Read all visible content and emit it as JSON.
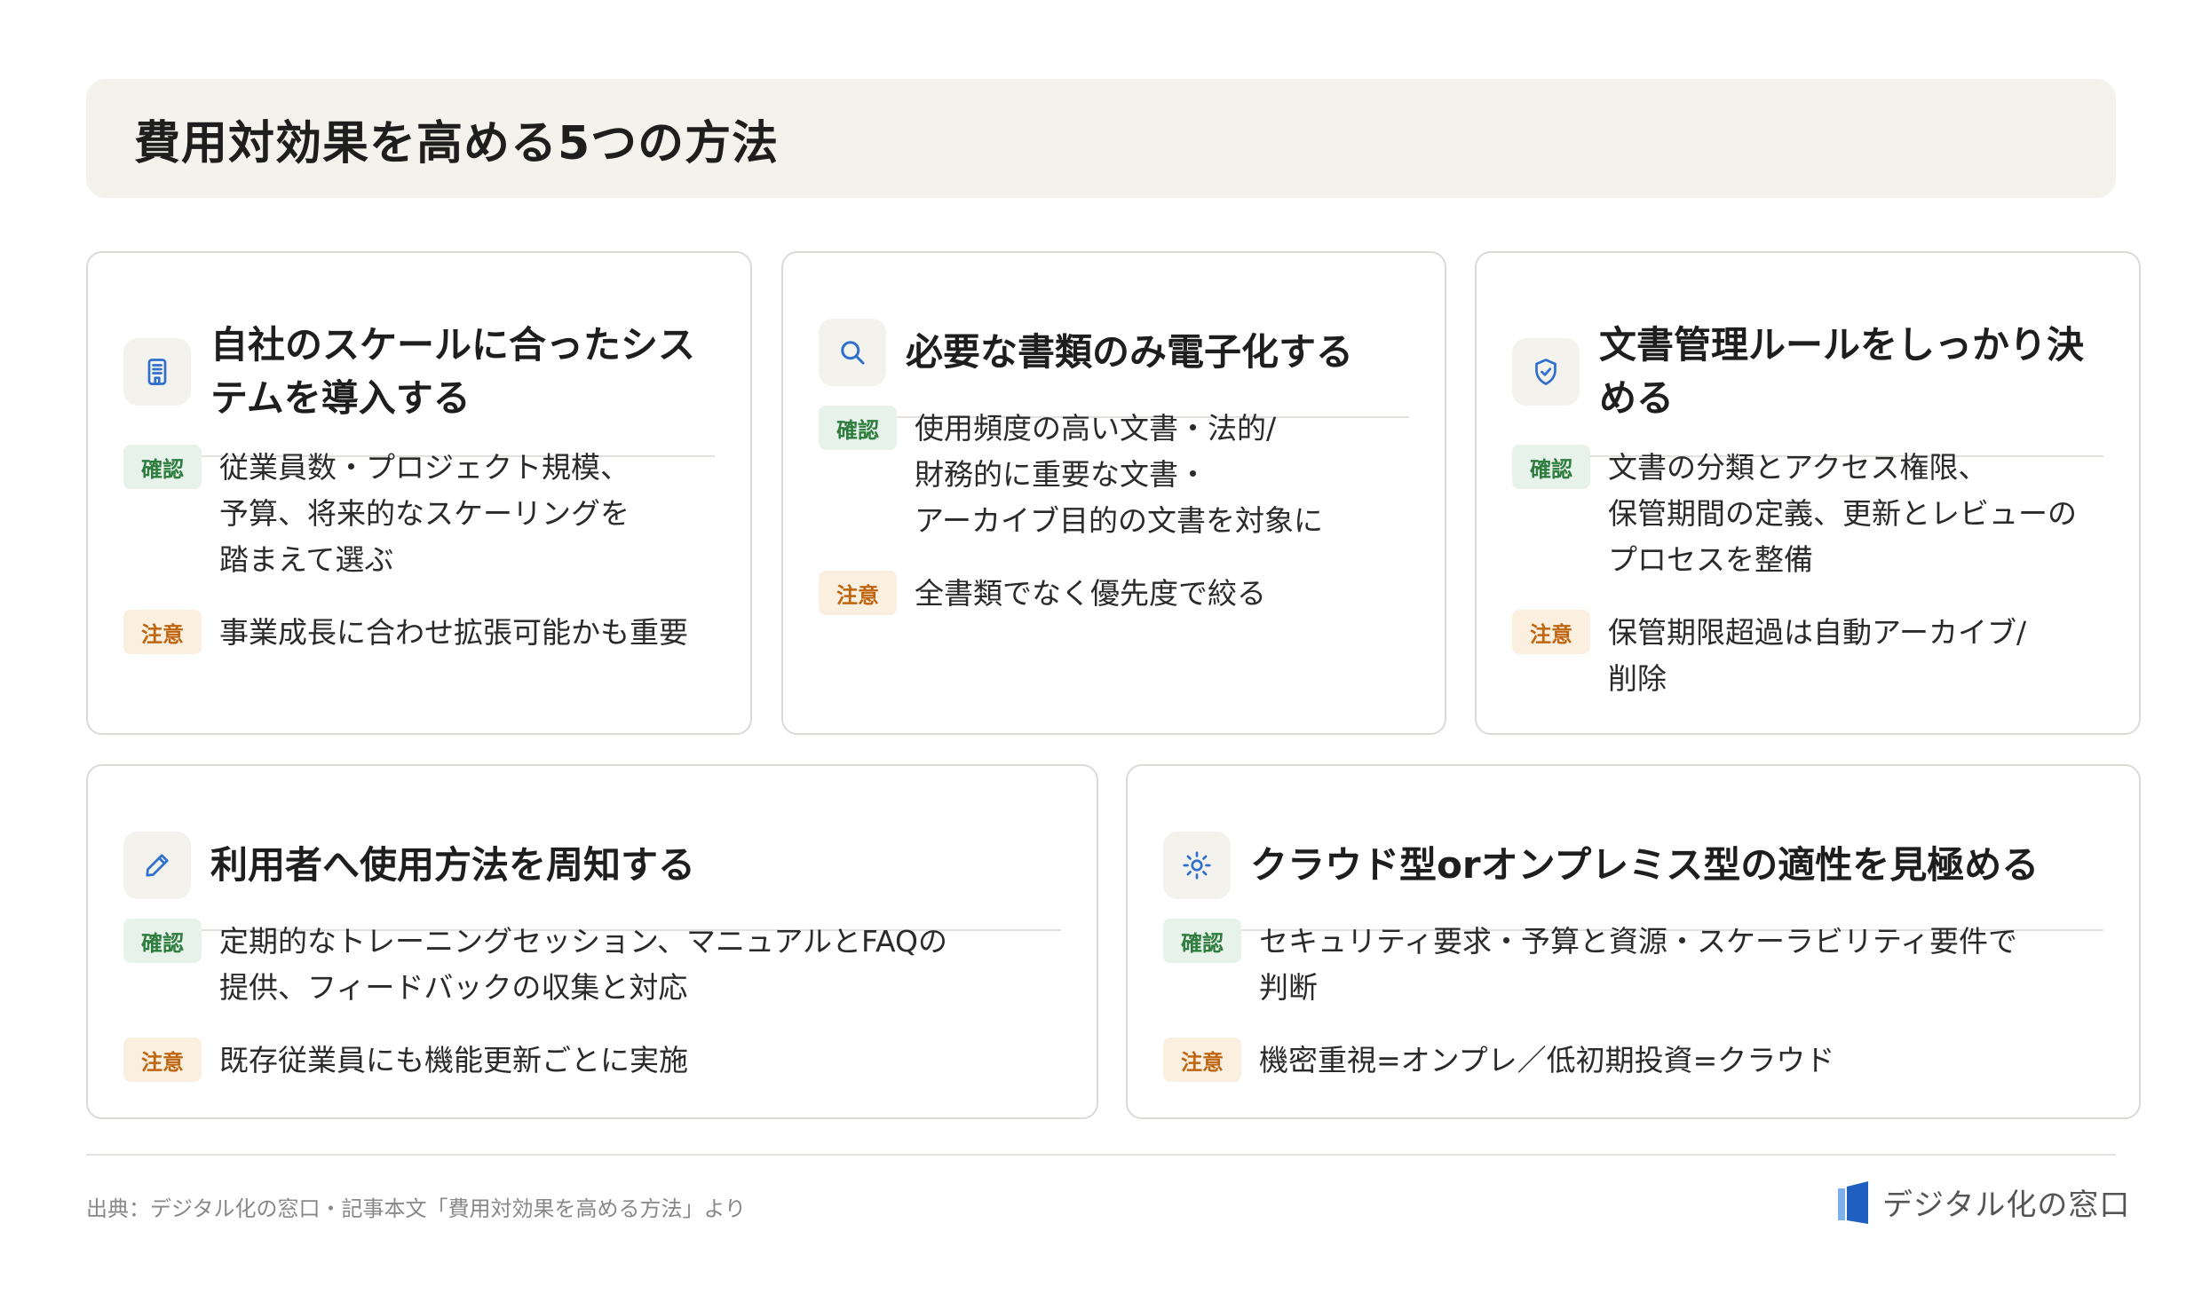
{
  "header": {
    "title": "費用対効果を高める5つの方法"
  },
  "cards": [
    {
      "icon": "building-icon",
      "title": "自社のスケールに合ったシステムを導入する",
      "rows": [
        {
          "badge": "確認",
          "text": "従業員数・プロジェクト規模、\n予算、将来的なスケーリングを\n踏まえて選ぶ"
        },
        {
          "badge": "注意",
          "text": "事業成長に合わせ拡張可能かも重要"
        }
      ]
    },
    {
      "icon": "search-icon",
      "title": "必要な書類のみ電子化する",
      "rows": [
        {
          "badge": "確認",
          "text": "使用頻度の高い文書・法的/\n財務的に重要な文書・\nアーカイブ目的の文書を対象に"
        },
        {
          "badge": "注意",
          "text": "全書類でなく優先度で絞る"
        }
      ]
    },
    {
      "icon": "shield-check-icon",
      "title": "文書管理ルールをしっかり決める",
      "rows": [
        {
          "badge": "確認",
          "text": "文書の分類とアクセス権限、\n保管期間の定義、更新とレビューの\nプロセスを整備"
        },
        {
          "badge": "注意",
          "text": "保管期限超過は自動アーカイブ/\n削除"
        }
      ]
    },
    {
      "icon": "pencil-icon",
      "title": "利用者へ使用方法を周知する",
      "rows": [
        {
          "badge": "確認",
          "text": "定期的なトレーニングセッション、マニュアルとFAQの\n提供、フィードバックの収集と対応"
        },
        {
          "badge": "注意",
          "text": "既存従業員にも機能更新ごとに実施"
        }
      ]
    },
    {
      "icon": "sun-icon",
      "title": "クラウド型orオンプレミス型の適性を見極める",
      "rows": [
        {
          "badge": "確認",
          "text": "セキュリティ要求・予算と資源・スケーラビリティ要件で\n判断"
        },
        {
          "badge": "注意",
          "text": "機密重視=オンプレ／低初期投資=クラウド"
        }
      ]
    }
  ],
  "footer": {
    "source": "出典：デジタル化の窓口・記事本文「費用対効果を高める方法」より",
    "brand": "デジタル化の窓口"
  },
  "colors": {
    "accent": "#2f6fce",
    "confirm_bg": "#e7f3ea",
    "confirm_text": "#2e7d3e",
    "caution_bg": "#fbefe0",
    "caution_text": "#c0650f",
    "header_bg": "#f4f2ec"
  }
}
